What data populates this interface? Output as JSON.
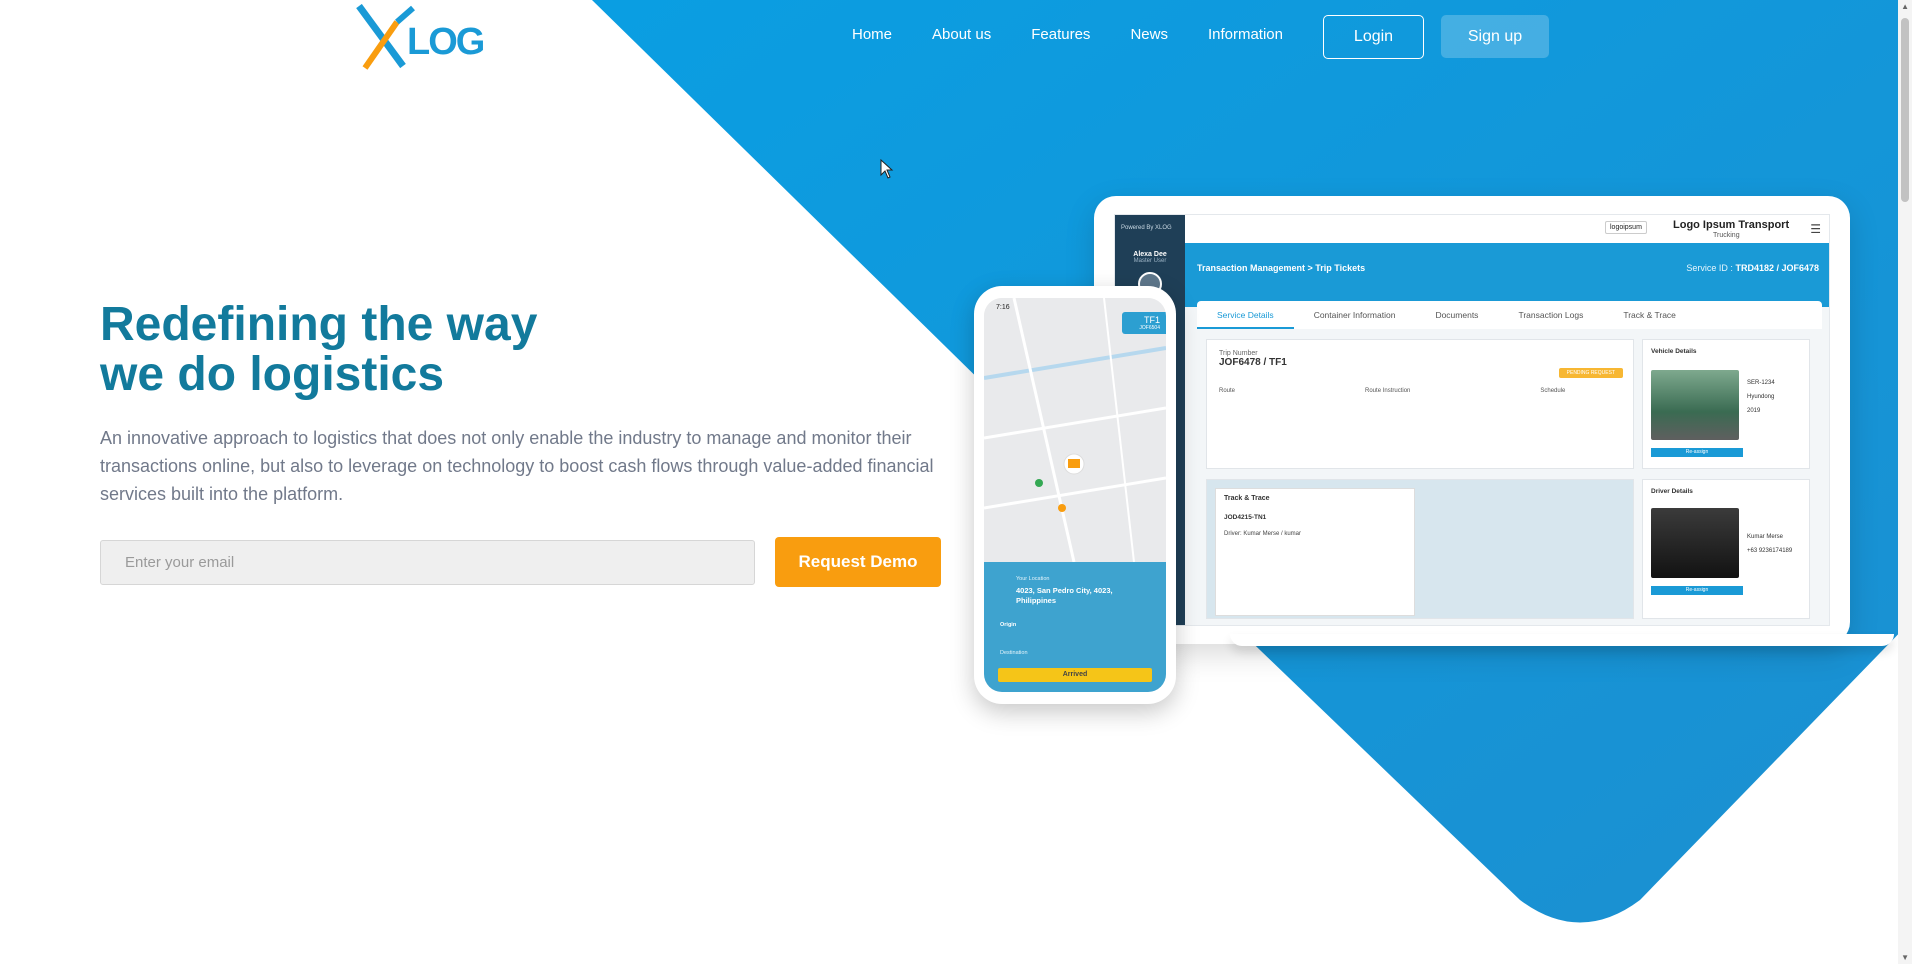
{
  "brand": {
    "logo_text": "LOG",
    "logo_letter": "X",
    "colors": {
      "blue": "#1a9ad6",
      "orange": "#f99d0f",
      "title": "#127a9c"
    }
  },
  "nav": {
    "items": [
      "Home",
      "About us",
      "Features",
      "News",
      "Information"
    ],
    "login_label": "Login",
    "signup_label": "Sign up"
  },
  "hero": {
    "title_line1": "Redefining the way",
    "title_line2": "we do logistics",
    "description": "An innovative approach to logistics that does not only enable the industry to manage and monitor their transactions online, but also to leverage on technology to boost cash flows through value-added financial services built into the platform.",
    "email_placeholder": "Enter your email",
    "demo_button": "Request Demo"
  },
  "mockup_laptop": {
    "sidebar_brand": "Powered By XLOG",
    "user_name": "Alexa Dee",
    "user_role": "Master User",
    "logoipsum": "logoipsum",
    "company_name": "Logo Ipsum Transport",
    "company_sub": "Trucking",
    "breadcrumb": "Transaction Management > Trip Tickets",
    "service_id_label": "Service ID :",
    "service_id": "TRD4182 / JOF6478",
    "tabs": [
      "Service Details",
      "Container Information",
      "Documents",
      "Transaction Logs",
      "Track & Trace"
    ],
    "trip_number_label": "Trip Number",
    "trip_number": "JOF6478 / TF1",
    "status_badge": "PENDING REQUEST",
    "route_headers": [
      "Route",
      "Route Instruction",
      "Schedule"
    ],
    "track_title": "Track & Trace",
    "track_id": "JOD4215-TN1",
    "track_driver": "Driver: Kumar Merse / kumar",
    "vehicle_title": "Vehicle Details",
    "vehicle_plate": "SER-1234",
    "vehicle_brand": "Hyundong",
    "vehicle_year": "2019",
    "driver_title": "Driver Details",
    "driver_name": "Kumar Merse",
    "driver_phone": "+63 9236174189",
    "reassign": "Re-assign"
  },
  "mockup_phone": {
    "time": "7:16",
    "tag": "TF1",
    "tag_sub": "JOF6504",
    "location_label": "Your Location",
    "location": "4023, San Pedro City, 4023, Philippines",
    "origin_label": "Origin",
    "destination_label": "Destination",
    "arrived": "Arrived"
  }
}
